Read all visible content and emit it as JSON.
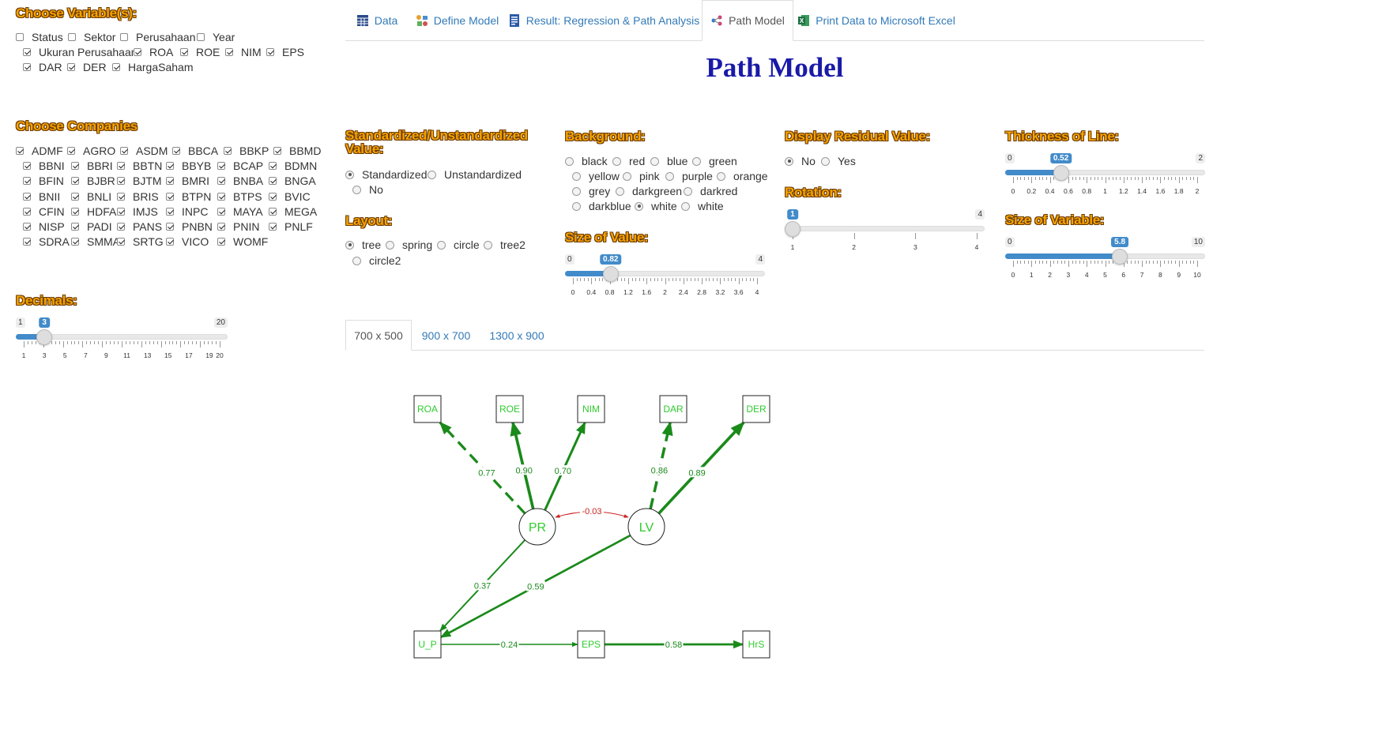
{
  "left": {
    "variables": {
      "title": "Choose Variable(s):",
      "items": [
        {
          "label": "Status",
          "checked": false
        },
        {
          "label": "Sektor",
          "checked": false
        },
        {
          "label": "Perusahaan",
          "checked": false
        },
        {
          "label": "Year",
          "checked": false
        },
        {
          "label": "Ukuran Perusahaan",
          "checked": true
        },
        {
          "label": "ROA",
          "checked": true
        },
        {
          "label": "ROE",
          "checked": true
        },
        {
          "label": "NIM",
          "checked": true
        },
        {
          "label": "EPS",
          "checked": true
        },
        {
          "label": "DAR",
          "checked": true
        },
        {
          "label": "DER",
          "checked": true
        },
        {
          "label": "HargaSaham",
          "checked": true
        }
      ]
    },
    "companies": {
      "title": "Choose Companies",
      "items": [
        "ADMF",
        "AGRO",
        "ASDM",
        "BBCA",
        "BBKP",
        "BBMD",
        "BBNI",
        "BBRI",
        "BBTN",
        "BBYB",
        "BCAP",
        "BDMN",
        "BFIN",
        "BJBR",
        "BJTM",
        "BMRI",
        "BNBA",
        "BNGA",
        "BNII",
        "BNLI",
        "BRIS",
        "BTPN",
        "BTPS",
        "BVIC",
        "CFIN",
        "HDFA",
        "IMJS",
        "INPC",
        "MAYA",
        "MEGA",
        "NISP",
        "PADI",
        "PANS",
        "PNBN",
        "PNIN",
        "PNLF",
        "SDRA",
        "SMMA",
        "SRTG",
        "VICO",
        "WOMF"
      ]
    },
    "decimals": {
      "title": "Decimals:",
      "min": 1,
      "max": 20,
      "value": 3,
      "min_label": "1",
      "max_label": "20",
      "value_label": "3",
      "ticks": [
        "1",
        "3",
        "5",
        "7",
        "9",
        "11",
        "13",
        "15",
        "17",
        "19",
        "20"
      ]
    }
  },
  "tabs": [
    {
      "label": "Data",
      "icon": "table-icon",
      "active": false
    },
    {
      "label": "Define Model",
      "icon": "model-icon",
      "active": false
    },
    {
      "label": "Result: Regression & Path Analysis",
      "icon": "report-icon",
      "active": false
    },
    {
      "label": "Path Model",
      "icon": "share-icon",
      "active": true
    },
    {
      "label": "Print Data to Microsoft Excel",
      "icon": "excel-icon",
      "active": false
    }
  ],
  "page_title": "Path Model",
  "options": {
    "std": {
      "title": "Standardized/Unstandardized Value:",
      "options": [
        "Standardized",
        "Unstandardized",
        "No"
      ],
      "selected": "Standardized"
    },
    "layout": {
      "title": "Layout:",
      "options": [
        "tree",
        "spring",
        "circle",
        "tree2",
        "circle2"
      ],
      "selected": "tree"
    },
    "background": {
      "title": "Background:",
      "options": [
        "black",
        "red",
        "blue",
        "green",
        "yellow",
        "pink",
        "purple",
        "orange",
        "grey",
        "darkgreen",
        "darkred",
        "darkblue",
        "white",
        "white"
      ],
      "selected_index": 12
    },
    "size_value": {
      "title": "Size of Value:",
      "min": 0,
      "max": 4,
      "value": 0.82,
      "min_label": "0",
      "max_label": "4",
      "value_label": "0.82",
      "ticks": [
        "0",
        "0.4",
        "0.8",
        "1.2",
        "1.6",
        "2",
        "2.4",
        "2.8",
        "3.2",
        "3.6",
        "4"
      ]
    },
    "residual": {
      "title": "Display Residual Value:",
      "options": [
        "No",
        "Yes"
      ],
      "selected": "No"
    },
    "rotation": {
      "title": "Rotation:",
      "min": 1,
      "max": 4,
      "value": 1,
      "min_label": "",
      "max_label": "4",
      "value_label": "1",
      "ticks": [
        "1",
        "2",
        "3",
        "4"
      ]
    },
    "thickness": {
      "title": "Thickness of Line:",
      "min": 0,
      "max": 2,
      "value": 0.52,
      "min_label": "0",
      "max_label": "2",
      "value_label": "0.52",
      "ticks": [
        "0",
        "0.2",
        "0.4",
        "0.6",
        "0.8",
        "1",
        "1.2",
        "1.4",
        "1.6",
        "1.8",
        "2"
      ]
    },
    "size_var": {
      "title": "Size of Variable:",
      "min": 0,
      "max": 10,
      "value": 5.8,
      "min_label": "0",
      "max_label": "10",
      "value_label": "5.8",
      "ticks": [
        "0",
        "1",
        "2",
        "3",
        "4",
        "5",
        "6",
        "7",
        "8",
        "9",
        "10"
      ]
    }
  },
  "size_tabs": [
    {
      "label": "700 x 500",
      "active": true
    },
    {
      "label": "900 x 700",
      "active": false
    },
    {
      "label": "1300 x 900",
      "active": false
    }
  ],
  "diagram": {
    "node_color": "#2ecc2e",
    "edge_color": "#1a8a1a",
    "cov_color": "#cc2222",
    "nodes": [
      {
        "id": "ROA",
        "label": "ROA",
        "shape": "box"
      },
      {
        "id": "ROE",
        "label": "ROE",
        "shape": "box"
      },
      {
        "id": "NIM",
        "label": "NIM",
        "shape": "box"
      },
      {
        "id": "DAR",
        "label": "DAR",
        "shape": "box"
      },
      {
        "id": "DER",
        "label": "DER",
        "shape": "box"
      },
      {
        "id": "PR",
        "label": "PR",
        "shape": "circle"
      },
      {
        "id": "LV",
        "label": "LV",
        "shape": "circle"
      },
      {
        "id": "U_P",
        "label": "U_P",
        "shape": "box"
      },
      {
        "id": "EPS",
        "label": "EPS",
        "shape": "box"
      },
      {
        "id": "HrS",
        "label": "HrS",
        "shape": "box"
      }
    ],
    "edges": [
      {
        "from": "PR",
        "to": "ROA",
        "label": "0.77",
        "dashed": true,
        "weight": 0.77
      },
      {
        "from": "PR",
        "to": "ROE",
        "label": "0.90",
        "dashed": false,
        "weight": 0.9
      },
      {
        "from": "PR",
        "to": "NIM",
        "label": "0.70",
        "dashed": false,
        "weight": 0.7
      },
      {
        "from": "LV",
        "to": "DAR",
        "label": "0.86",
        "dashed": true,
        "weight": 0.86
      },
      {
        "from": "LV",
        "to": "DER",
        "label": "0.89",
        "dashed": false,
        "weight": 0.89
      },
      {
        "from": "PR",
        "to": "U_P",
        "label": "0.37",
        "dashed": false,
        "weight": 0.37
      },
      {
        "from": "LV",
        "to": "U_P",
        "label": "0.59",
        "dashed": false,
        "weight": 0.59
      },
      {
        "from": "U_P",
        "to": "EPS",
        "label": "0.24",
        "dashed": false,
        "weight": 0.24
      },
      {
        "from": "EPS",
        "to": "HrS",
        "label": "0.58",
        "dashed": false,
        "weight": 0.58
      }
    ],
    "covariances": [
      {
        "a": "PR",
        "b": "LV",
        "label": "-0.03"
      }
    ]
  }
}
